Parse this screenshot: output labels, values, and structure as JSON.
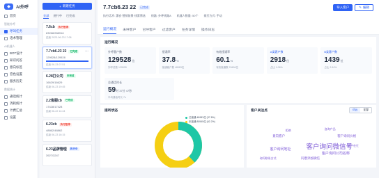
{
  "app": {
    "name": "AI外呼"
  },
  "sidebar": {
    "items": [
      {
        "label": "首页",
        "icon": "home-icon"
      },
      {
        "section": "智能外呼"
      },
      {
        "label": "呼叫任务",
        "icon": "phone-icon",
        "active": true
      },
      {
        "label": "话术管理",
        "icon": "script-icon"
      },
      {
        "section": "AI机器人"
      },
      {
        "label": "BOT设计",
        "icon": "bot-icon"
      },
      {
        "label": "知识问答",
        "icon": "qa-icon"
      },
      {
        "label": "意向标签",
        "icon": "tag-icon"
      },
      {
        "label": "音色设置",
        "icon": "voice-icon"
      },
      {
        "label": "服务历史",
        "icon": "history-icon"
      },
      {
        "section": "数据统计"
      },
      {
        "label": "通话统计",
        "icon": "stats-icon"
      },
      {
        "label": "消耗统计",
        "icon": "usage-icon"
      },
      {
        "label": "计费汇总",
        "icon": "bill-icon"
      },
      {
        "label": "设置",
        "icon": "settings-icon"
      }
    ]
  },
  "tasks": {
    "new_label": "新建任务",
    "tabs": [
      "全部",
      "进行中",
      "已完成"
    ],
    "list": [
      {
        "title": "7.6cb",
        "badge": "执行暂停",
        "badge_type": "red",
        "nums": "83268/288916",
        "time": "结束 2023-06-23 17:08"
      },
      {
        "title": "7.7cb6.23 22",
        "badge": "已完成",
        "badge_type": "green",
        "nums": "129528/129528",
        "time": "结束 06-23 07:51",
        "progress": 1.0,
        "selected": true
      },
      {
        "title": "6.28打公司",
        "badge": "已完成",
        "badge_type": "green",
        "nums": "16629/16629",
        "time": "结束 06-23 19:45"
      },
      {
        "title": "2.2客服cb",
        "badge": "已完成",
        "badge_type": "green",
        "nums": "17428/17428",
        "time": "结束 06-22 14:44"
      },
      {
        "title": "6.23cb",
        "badge": "执行暂停",
        "badge_type": "red",
        "nums": "48862/48862",
        "time": "结束 06-23 16:15"
      },
      {
        "title": "6.23品牌管理",
        "badge": "执行中",
        "badge_type": "blue",
        "nums": "3927/3247",
        "time": ""
      }
    ]
  },
  "header": {
    "title": "7.7cb6.23 22",
    "status": "已完成",
    "meta": [
      "执行话术: 惠农·营销前景·线索筛选",
      "线路: 外呼线路A",
      "机器人数量: 50个",
      "拨打方式: 手动"
    ],
    "add_customer": "导入客户",
    "edit": "编辑"
  },
  "tabs": [
    "运行概况",
    "未呼客户",
    "已呼客户",
    "过滤客户",
    "任务详情",
    "操作日志"
  ],
  "overview": {
    "title": "运行概况",
    "stats": [
      {
        "label": "外呼客户数",
        "value": "129528",
        "unit": "位",
        "sub": "外呼总数 129528"
      },
      {
        "label": "接通率",
        "value": "37.8",
        "unit": "%",
        "sub": "接通客户数 48983位"
      },
      {
        "label": "有效接通率",
        "value": "60.1",
        "unit": "%",
        "sub": "有效接通数 29456位"
      },
      {
        "label": "A类客户数",
        "value": "2918",
        "unit": "位",
        "sub": "占比 1.06%",
        "blue": true
      },
      {
        "label": "B类客户数",
        "value": "1439",
        "unit": "位",
        "sub": "占比 2.94%",
        "blue": true
      }
    ],
    "duration": {
      "label": "总通话时长",
      "value": "59",
      "unit": "时 37分 47秒",
      "sub": "平均通话时长 7s"
    }
  },
  "connect_status": {
    "title": "接听状态",
    "legend": [
      "已接通 48983位 (37.8%)",
      "未接通 80545位 (62.2%)"
    ],
    "colors": [
      "#1ec7a6",
      "#f5cf13"
    ]
  },
  "focus": {
    "title": "客户关注点",
    "toggle": [
      "词云",
      "全部"
    ],
    "words": [
      "客户询问微信号",
      "客户询问公司名称",
      "客户询问价格",
      "客户询问地址",
      "意向客户",
      "咨询产品",
      "拒绝",
      "同意添加微信",
      "客户在忙",
      "询问联系方式"
    ]
  }
}
